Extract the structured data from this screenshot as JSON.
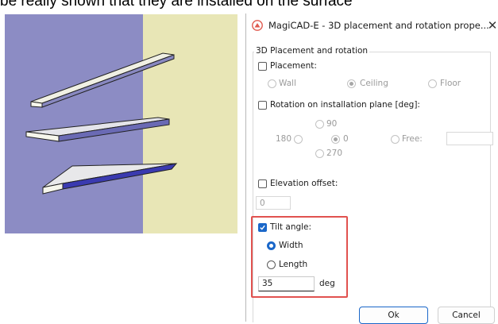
{
  "caption": "be really shown that they are installed on the surface",
  "dialog": {
    "title": "MagiCAD-E - 3D placement and rotation prope...",
    "close_symbol": "✕",
    "group_title": "3D Placement and rotation",
    "placement": {
      "label": "Placement:",
      "checked": false,
      "options": [
        "Wall",
        "Ceiling",
        "Floor"
      ],
      "selected": "Ceiling"
    },
    "rotation": {
      "label": "Rotation on installation plane [deg]:",
      "checked": false,
      "options": {
        "top": "90",
        "left": "180",
        "center": "0",
        "bottom": "270",
        "free": "Free:"
      },
      "selected": "0",
      "free_value": ""
    },
    "elevation": {
      "label": "Elevation offset:",
      "checked": false,
      "value": "0"
    },
    "tilt": {
      "label": "Tilt angle:",
      "checked": true,
      "options": [
        "Width",
        "Length"
      ],
      "selected": "Width",
      "value": "35",
      "unit": "deg"
    },
    "buttons": {
      "ok": "Ok",
      "cancel": "Cancel"
    }
  },
  "colors": {
    "accent": "#1a67c9",
    "highlight": "#e1524f",
    "viewport_left": "#8c8cc4",
    "viewport_right": "#e8e6b6"
  },
  "icons": {
    "app": "magicad-logo-icon",
    "close": "close-icon",
    "check": "checkmark-icon"
  }
}
